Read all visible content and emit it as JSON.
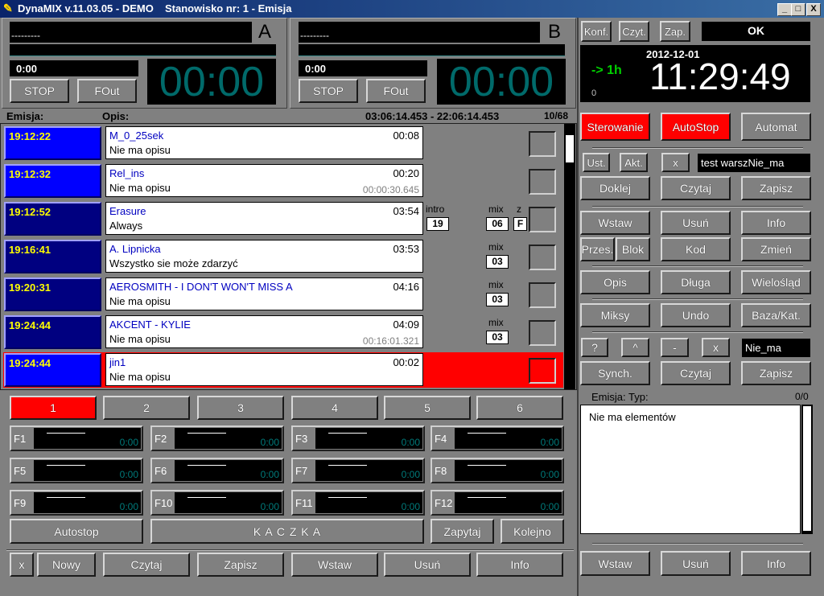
{
  "window": {
    "title": "DynaMIX v.11.03.05 - DEMO",
    "subtitle": "Stanowisko nr: 1 - Emisja",
    "min": "_",
    "max": "□",
    "close": "X"
  },
  "players": [
    {
      "track": "---------",
      "letter": "A",
      "time": "0:00",
      "stop": "STOP",
      "fout": "FOut",
      "clock": "00:00"
    },
    {
      "track": "---------",
      "letter": "B",
      "time": "0:00",
      "stop": "STOP",
      "fout": "FOut",
      "clock": "00:00"
    }
  ],
  "top_right": {
    "konf": "Konf.",
    "czyt": "Czyt.",
    "zap": "Zap.",
    "status": "OK",
    "date": "2012-12-01",
    "offset": "-> 1h",
    "small": "0",
    "clock": "11:29:49"
  },
  "playlist": {
    "col_emisja": "Emisja:",
    "col_opis": "Opis:",
    "range": "03:06:14.453 - 22:06:14.453",
    "count": "10/68",
    "rows": [
      {
        "time": "19:12:22",
        "title": "M_0_25sek",
        "dur": "00:08",
        "sub": "Nie ma opisu",
        "total": ""
      },
      {
        "time": "19:12:32",
        "title": "Rel_ins",
        "dur": "00:20",
        "sub": "Nie ma opisu",
        "total": "00:00:30.645"
      },
      {
        "time": "19:12:52",
        "title": "Erasure",
        "dur": "03:54",
        "sub": "Always",
        "total": "",
        "intro_label": "intro",
        "intro": "19",
        "mix_label": "mix",
        "mix": "06",
        "z_label": "z",
        "z": "F"
      },
      {
        "time": "19:16:41",
        "title": "A. Lipnicka",
        "dur": "03:53",
        "sub": "Wszystko sie może zdarzyć",
        "total": "",
        "mix_label": "mix",
        "mix": "03"
      },
      {
        "time": "19:20:31",
        "title": "AEROSMITH - I DON'T WON'T MISS A",
        "dur": "04:16",
        "sub": "Nie ma opisu",
        "total": "",
        "mix_label": "mix",
        "mix": "03"
      },
      {
        "time": "19:24:44",
        "title": "AKCENT - KYLIE",
        "dur": "04:09",
        "sub": "Nie ma opisu",
        "total": "00:16:01.321",
        "mix_label": "mix",
        "mix": "03"
      },
      {
        "time": "19:24:44",
        "title": "jin1",
        "dur": "00:02",
        "sub": "Nie ma opisu",
        "total": ""
      }
    ]
  },
  "pages": [
    "1",
    "2",
    "3",
    "4",
    "5",
    "6"
  ],
  "fkeys": [
    {
      "label": "F1",
      "time": "0:00"
    },
    {
      "label": "F2",
      "time": "0:00"
    },
    {
      "label": "F3",
      "time": "0:00"
    },
    {
      "label": "F4",
      "time": "0:00"
    },
    {
      "label": "F5",
      "time": "0:00"
    },
    {
      "label": "F6",
      "time": "0:00"
    },
    {
      "label": "F7",
      "time": "0:00"
    },
    {
      "label": "F8",
      "time": "0:00"
    },
    {
      "label": "F9",
      "time": "0:00"
    },
    {
      "label": "F10",
      "time": "0:00"
    },
    {
      "label": "F11",
      "time": "0:00"
    },
    {
      "label": "F12",
      "time": "0:00"
    }
  ],
  "bottom_left": {
    "autostop": "Autostop",
    "kaczka": "K A C Z K A",
    "zapytaj": "Zapytaj",
    "kolejno": "Kolejno",
    "x": "x",
    "nowy": "Nowy",
    "czytaj": "Czytaj",
    "zapisz": "Zapisz",
    "wstaw": "Wstaw",
    "usun": "Usuń",
    "info": "Info"
  },
  "right_panel": {
    "sterowanie": "Sterowanie",
    "autostop": "AutoStop",
    "automat": "Automat",
    "ust": "Ust.",
    "akt": "Akt.",
    "x": "x",
    "field1": "test warszNie_ma",
    "doklej": "Doklej",
    "czytaj": "Czytaj",
    "zapisz": "Zapisz",
    "wstaw": "Wstaw",
    "usun": "Usuń",
    "info": "Info",
    "przes": "Przes.",
    "blok": "Blok",
    "kod": "Kod",
    "zmien": "Zmień",
    "opis": "Opis",
    "dluga": "Długa",
    "wieloslad": "Wielośląd",
    "miksy": "Miksy",
    "undo": "Undo",
    "baza": "Baza/Kat.",
    "q": "?",
    "up": "^",
    "minus": "-",
    "x2": "x",
    "field2": "Nie_ma",
    "synch": "Synch.",
    "czytaj2": "Czytaj",
    "zapisz2": "Zapisz",
    "emisja_label": "Emisja: Typ:",
    "emisja_count": "0/0",
    "empty": "Nie ma elementów",
    "b_wstaw": "Wstaw",
    "b_usun": "Usuń",
    "b_info": "Info"
  }
}
